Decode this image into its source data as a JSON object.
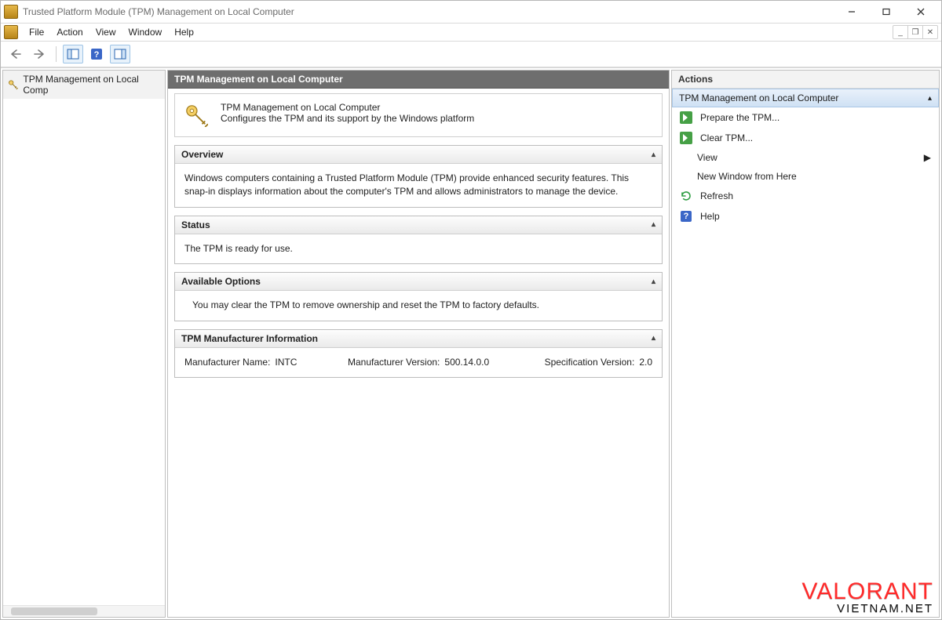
{
  "window": {
    "title": "Trusted Platform Module (TPM) Management on Local Computer"
  },
  "menu": {
    "file": "File",
    "action": "Action",
    "view": "View",
    "window": "Window",
    "help": "Help"
  },
  "tree": {
    "node": "TPM Management on Local Comp"
  },
  "main": {
    "bar_title": "TPM Management on Local Computer",
    "intro_title": "TPM Management on Local Computer",
    "intro_sub": "Configures the TPM and its support by the Windows platform",
    "overview": {
      "title": "Overview",
      "body": "Windows computers containing a Trusted Platform Module (TPM) provide enhanced security features. This snap-in displays information about the computer's TPM and allows administrators to manage the device."
    },
    "status": {
      "title": "Status",
      "body": "The TPM is ready for use."
    },
    "options": {
      "title": "Available Options",
      "body": "You may clear the TPM to remove ownership and reset the TPM to factory defaults."
    },
    "mfr": {
      "title": "TPM Manufacturer Information",
      "name_label": "Manufacturer Name:",
      "name_value": "INTC",
      "ver_label": "Manufacturer Version:",
      "ver_value": "500.14.0.0",
      "spec_label": "Specification Version:",
      "spec_value": "2.0"
    }
  },
  "actions": {
    "header": "Actions",
    "group": "TPM Management on Local Computer",
    "prepare": "Prepare the TPM...",
    "clear": "Clear TPM...",
    "view": "View",
    "new_window": "New Window from Here",
    "refresh": "Refresh",
    "help": "Help"
  },
  "watermark": {
    "line1": "VALORANT",
    "line2": "VIETNAM.NET"
  }
}
